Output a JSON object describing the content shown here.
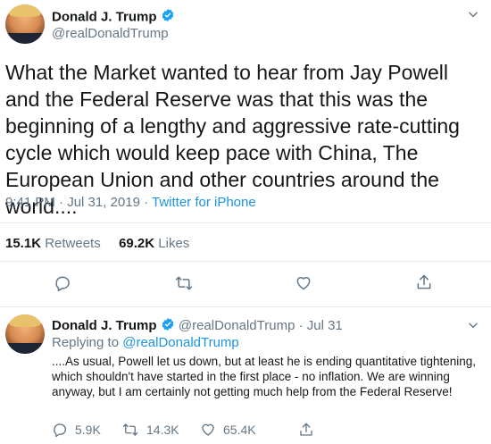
{
  "main_tweet": {
    "author_name": "Donald J. Trump",
    "author_handle": "@realDonaldTrump",
    "text": "What the Market wanted to hear from Jay Powell and the Federal Reserve was that this was the beginning of a lengthy and aggressive rate-cutting cycle which would keep pace with China, The European Union and other countries around the world....",
    "time": "9:41 PM · Jul 31, 2019 · ",
    "source": "Twitter for iPhone",
    "retweets_count": "15.1K",
    "retweets_label": " Retweets",
    "likes_count": "69.2K",
    "likes_label": " Likes"
  },
  "reply_tweet": {
    "author_name": "Donald J. Trump",
    "author_handle": "@realDonaldTrump",
    "date": " · Jul 31",
    "replying_prefix": "Replying to ",
    "replying_handle": "@realDonaldTrump",
    "text": "....As usual, Powell let us down, but at least he is ending quantitative tightening, which shouldn't have started in the first place - no inflation. We are winning anyway, but I am certainly not getting much help from the Federal Reserve!",
    "replies": "5.9K",
    "retweets": "14.3K",
    "likes": "65.4K"
  },
  "icons": {
    "verified": "verified-badge-icon",
    "more": "chevron-down-icon",
    "reply": "reply-icon",
    "retweet": "retweet-icon",
    "like": "heart-icon",
    "share": "share-icon"
  },
  "colors": {
    "accent": "#1da1f2",
    "link": "#1b95e0",
    "muted": "#657786",
    "text": "#14171a"
  }
}
